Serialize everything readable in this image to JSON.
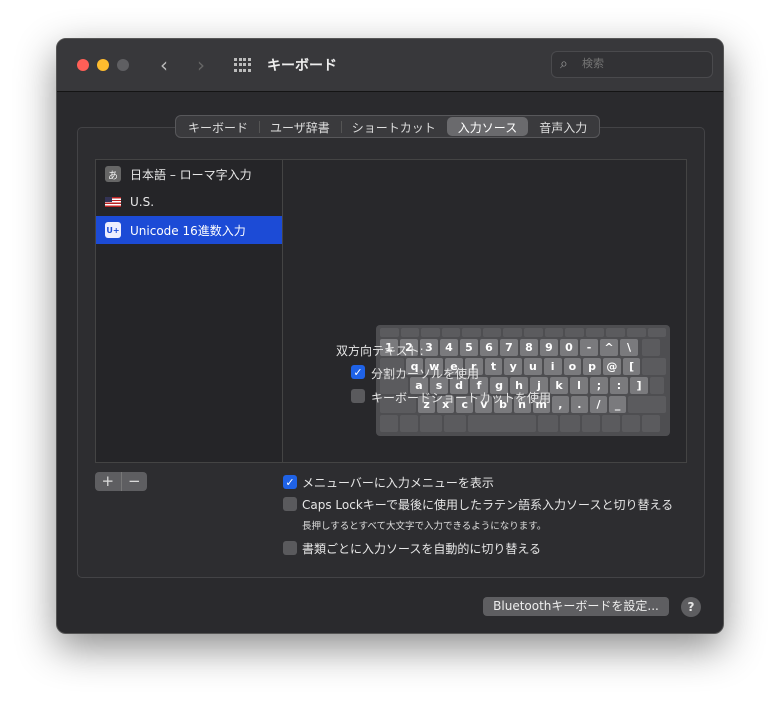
{
  "window": {
    "title": "キーボード",
    "search_placeholder": "検索"
  },
  "tabs": [
    "キーボード",
    "ユーザ辞書",
    "ショートカット",
    "入力ソース",
    "音声入力"
  ],
  "active_tab": 3,
  "sources": [
    {
      "label": "日本語 – ローマ字入力",
      "badge": "あ"
    },
    {
      "label": "U.S.",
      "badge": ""
    },
    {
      "label": "Unicode 16進数入力",
      "badge": "U+"
    }
  ],
  "keyboard": {
    "rows": [
      [
        "1",
        "2",
        "3",
        "4",
        "5",
        "6",
        "7",
        "8",
        "9",
        "0",
        "-",
        "^",
        "\\"
      ],
      [
        "q",
        "w",
        "e",
        "r",
        "t",
        "y",
        "u",
        "i",
        "o",
        "p",
        "@",
        "["
      ],
      [
        "a",
        "s",
        "d",
        "f",
        "g",
        "h",
        "j",
        "k",
        "l",
        ";",
        ":",
        "]"
      ],
      [
        "z",
        "x",
        "c",
        "v",
        "b",
        "n",
        "m",
        ",",
        ".",
        "/",
        "_"
      ]
    ]
  },
  "bidi": {
    "heading": "双方向テキスト:",
    "split_cursor": "分割カーソルを使用",
    "split_cursor_checked": true,
    "shortcut": "キーボードショートカットを使用",
    "shortcut_checked": false
  },
  "options": {
    "show_menu": "メニューバーに入力メニューを表示",
    "show_menu_checked": true,
    "caps_lock": "Caps Lockキーで最後に使用したラテン語系入力ソースと切り替える",
    "caps_lock_checked": false,
    "caps_note": "長押しするとすべて大文字で入力できるようになります。",
    "auto_switch": "書類ごとに入力ソースを自動的に切り替える",
    "auto_switch_checked": false
  },
  "buttons": {
    "add": "+",
    "remove": "−",
    "bluetooth": "Bluetoothキーボードを設定...",
    "help": "?"
  },
  "colors": {
    "accent": "#1c4bd6",
    "close": "#ff5f57",
    "minimize": "#febc2e"
  }
}
